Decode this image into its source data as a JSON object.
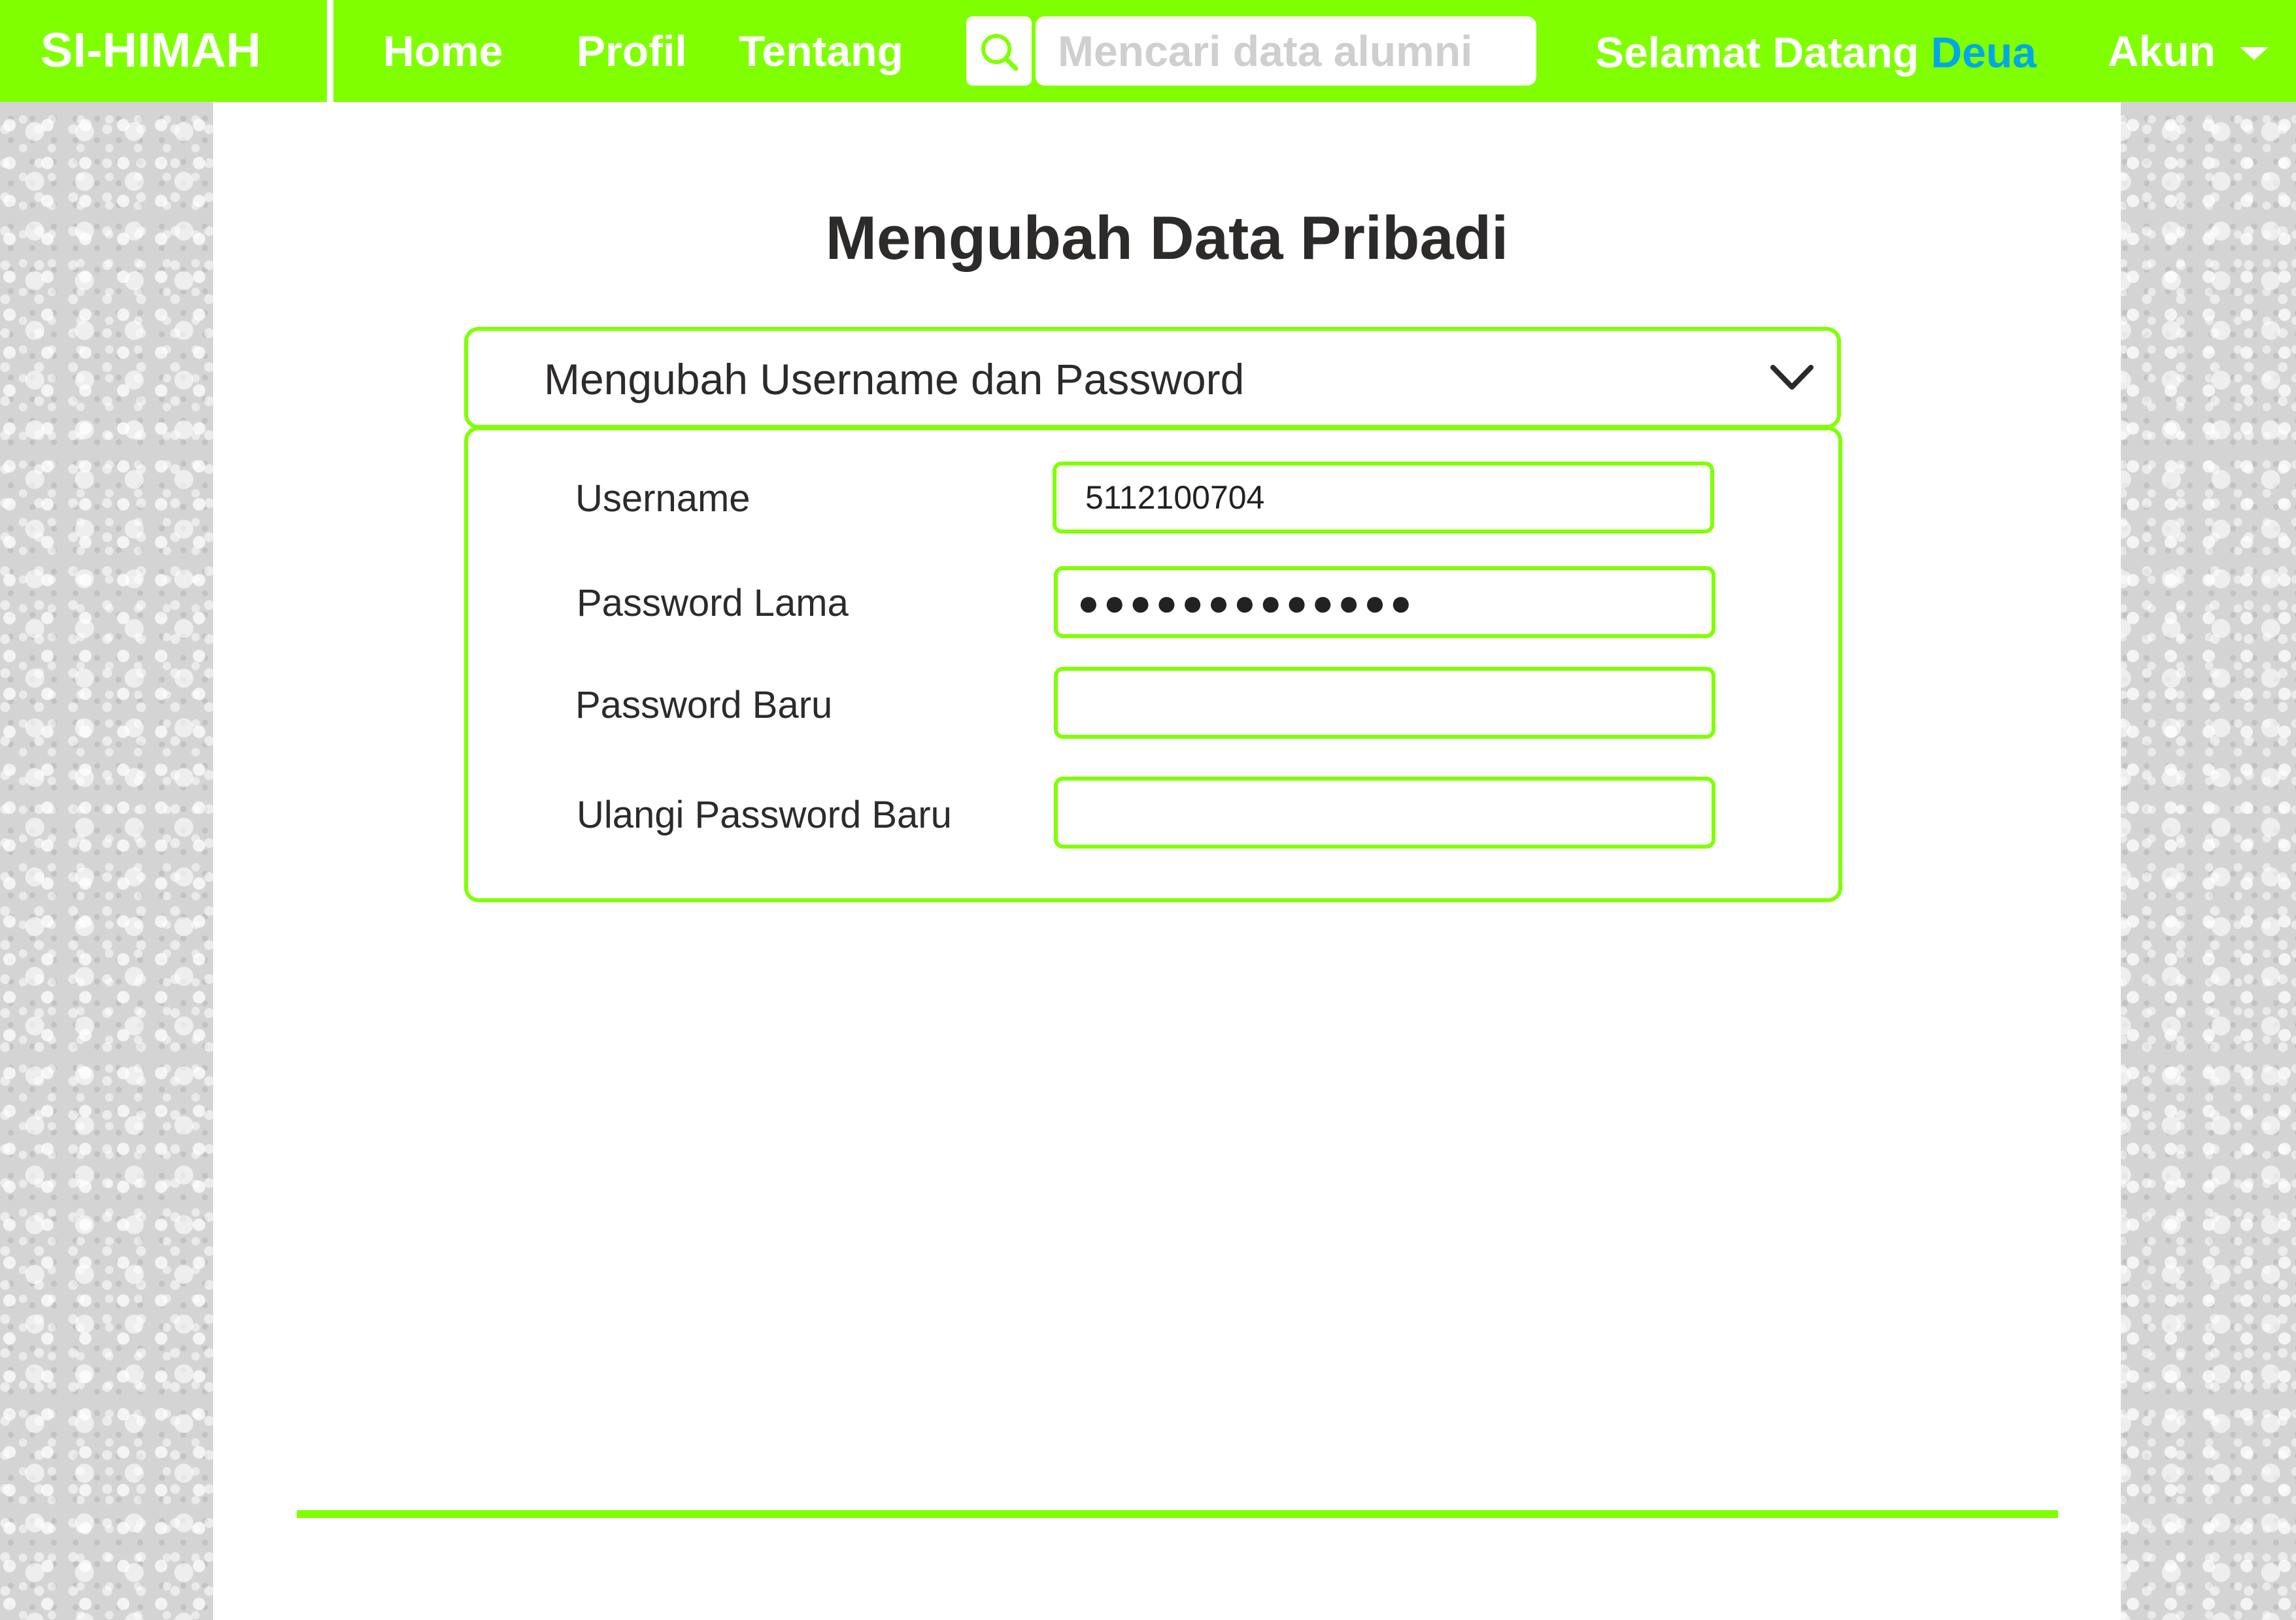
{
  "navbar": {
    "brand": "SI-HIMAH",
    "links": [
      "Home",
      "Profil",
      "Tentang"
    ],
    "search_placeholder": "Mencari data alumni",
    "search_icon": "search-icon",
    "welcome_text": "Selamat Datang",
    "username": "Deua",
    "account_label": "Akun",
    "account_icon": "caret-down-icon",
    "accent_color": "#80ff00",
    "username_color": "#00a8e6"
  },
  "page": {
    "title": "Mengubah Data Pribadi"
  },
  "section": {
    "title": "Mengubah Username dan Password",
    "expand_icon": "chevron-down-icon",
    "expanded": true
  },
  "form": {
    "username_label": "Username",
    "username_value": "5112100704",
    "old_password_label": "Password Lama",
    "old_password_value": "●●●●●●●●●●●●●",
    "new_password_label": "Password Baru",
    "new_password_value": "",
    "repeat_password_label": "Ulangi Password Baru",
    "repeat_password_value": ""
  }
}
